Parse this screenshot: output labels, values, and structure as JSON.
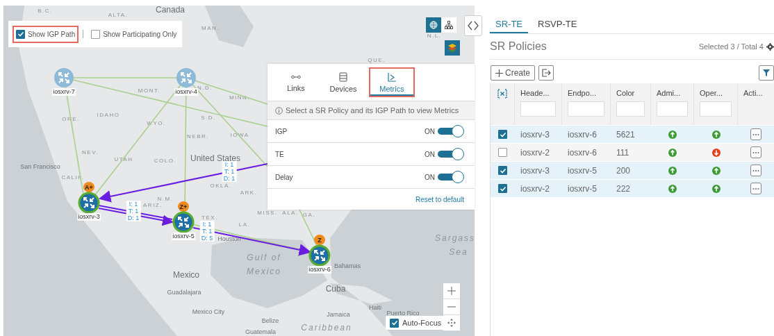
{
  "map": {
    "places": [
      {
        "name": "Canada",
        "kind": "country"
      },
      {
        "name": "B.C.",
        "kind": "region"
      },
      {
        "name": "ALTA.",
        "kind": "region"
      },
      {
        "name": "MAN.",
        "kind": "region"
      },
      {
        "name": "QUE.",
        "kind": "region"
      },
      {
        "name": "N.L.",
        "kind": "region"
      },
      {
        "name": "MONT.",
        "kind": "region"
      },
      {
        "name": "N.D.",
        "kind": "region"
      },
      {
        "name": "MINN.",
        "kind": "region"
      },
      {
        "name": "ORE.",
        "kind": "region"
      },
      {
        "name": "IDAHO",
        "kind": "region"
      },
      {
        "name": "S.D.",
        "kind": "region"
      },
      {
        "name": "WYO.",
        "kind": "region"
      },
      {
        "name": "NEBR.",
        "kind": "region"
      },
      {
        "name": "IOWA",
        "kind": "region"
      },
      {
        "name": "NEV.",
        "kind": "region"
      },
      {
        "name": "UTAH",
        "kind": "region"
      },
      {
        "name": "COLO.",
        "kind": "region"
      },
      {
        "name": "CALIF.",
        "kind": "region"
      },
      {
        "name": "San Francisco",
        "kind": "city"
      },
      {
        "name": "United States",
        "kind": "country"
      },
      {
        "name": "OKLA.",
        "kind": "region"
      },
      {
        "name": "ARK.",
        "kind": "region"
      },
      {
        "name": "ARIZ.",
        "kind": "region"
      },
      {
        "name": "N.M.",
        "kind": "region"
      },
      {
        "name": "TEX.",
        "kind": "region"
      },
      {
        "name": "MISS.",
        "kind": "region"
      },
      {
        "name": "ALA.",
        "kind": "region"
      },
      {
        "name": "GA.",
        "kind": "region"
      },
      {
        "name": "LA.",
        "kind": "region"
      },
      {
        "name": "Houston",
        "kind": "city"
      },
      {
        "name": "Gulf of",
        "kind": "water"
      },
      {
        "name": "Mexico",
        "kind": "water"
      },
      {
        "name": "Mexico",
        "kind": "country"
      },
      {
        "name": "Bahamas",
        "kind": "city"
      },
      {
        "name": "Sargass",
        "kind": "water"
      },
      {
        "name": "Sea",
        "kind": "water"
      },
      {
        "name": "Cuba",
        "kind": "country"
      },
      {
        "name": "Guadalajara",
        "kind": "city"
      },
      {
        "name": "Mexico City",
        "kind": "city"
      },
      {
        "name": "Haiti",
        "kind": "city"
      },
      {
        "name": "Jamaica",
        "kind": "city"
      },
      {
        "name": "Puerto Rico",
        "kind": "city"
      },
      {
        "name": "Belize",
        "kind": "city"
      },
      {
        "name": "Guatemala",
        "kind": "city"
      },
      {
        "name": "Caribbean",
        "kind": "water"
      }
    ],
    "nodes": [
      {
        "name": "iosxrv-7",
        "highlighted": false
      },
      {
        "name": "iosxrv-4",
        "highlighted": false
      },
      {
        "name": "iosxrv-3",
        "highlighted": true,
        "badge": "A+"
      },
      {
        "name": "iosxrv-5",
        "highlighted": true,
        "badge": "Z+"
      },
      {
        "name": "iosxrv-6",
        "highlighted": true,
        "badge": "Z"
      }
    ],
    "metric_labels": [
      {
        "lines": [
          "I: 1",
          "T: 1",
          "D: 1"
        ]
      },
      {
        "lines": [
          "I: 1",
          "T: 1",
          "D: 1"
        ]
      },
      {
        "lines": [
          "I: 1",
          "T: 1",
          "D: 5"
        ]
      }
    ],
    "filter_options": [
      {
        "label": "Show IGP Path",
        "checked": true,
        "highlighted": true
      },
      {
        "label": "Show Participating Only",
        "checked": false,
        "highlighted": false
      }
    ],
    "view_buttons": [
      {
        "kind": "globe",
        "selected": true
      },
      {
        "kind": "topology",
        "selected": false
      }
    ],
    "layers_panel": {
      "tabs": [
        {
          "label": "Links",
          "kind": "links",
          "selected": false,
          "highlighted": false
        },
        {
          "label": "Devices",
          "kind": "devices",
          "selected": false,
          "highlighted": false
        },
        {
          "label": "Metrics",
          "kind": "metrics",
          "selected": true,
          "highlighted": true
        }
      ],
      "info": "Select a SR Policy and its IGP Path to view Metrics",
      "toggles": [
        {
          "label": "IGP",
          "state": "ON",
          "on": true
        },
        {
          "label": "TE",
          "state": "ON",
          "on": true
        },
        {
          "label": "Delay",
          "state": "ON",
          "on": true
        }
      ],
      "reset": "Reset to default"
    },
    "auto_focus": {
      "label": "Auto-Focus",
      "checked": true
    }
  },
  "policies_panel": {
    "tabs": [
      {
        "label": "SR-TE",
        "selected": true
      },
      {
        "label": "RSVP-TE",
        "selected": false
      }
    ],
    "title": "SR Policies",
    "summary": "Selected 3 / Total 4",
    "create": "Create",
    "columns": [
      "Heade...",
      "Endpo...",
      "Color",
      "Admi...",
      "Oper...",
      "Acti..."
    ],
    "rows": [
      {
        "selected": true,
        "headend": "iosxrv-3",
        "endpoint": "iosxrv-6",
        "policy_color": "5621",
        "admin_up": true,
        "oper_up": true
      },
      {
        "selected": false,
        "headend": "iosxrv-2",
        "endpoint": "iosxrv-6",
        "policy_color": "111",
        "admin_up": true,
        "oper_up": false
      },
      {
        "selected": true,
        "headend": "iosxrv-3",
        "endpoint": "iosxrv-5",
        "policy_color": "200",
        "admin_up": true,
        "oper_up": true
      },
      {
        "selected": true,
        "headend": "iosxrv-2",
        "endpoint": "iosxrv-5",
        "policy_color": "222",
        "admin_up": true,
        "oper_up": true
      }
    ]
  }
}
